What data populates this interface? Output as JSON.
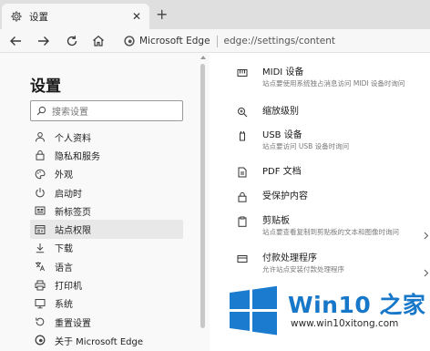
{
  "tab": {
    "title": "设置",
    "icon": "gear-icon",
    "close": "✕",
    "new_tab": "+"
  },
  "toolbar": {
    "back": "back-arrow-icon",
    "forward": "forward-arrow-icon",
    "refresh": "refresh-icon",
    "home": "home-icon"
  },
  "address": {
    "brand": "Microsoft Edge",
    "url": "edge://settings/content"
  },
  "sidebar": {
    "title": "设置",
    "search_placeholder": "搜索设置",
    "items": [
      {
        "label": "个人资料",
        "icon": "person-icon",
        "active": false
      },
      {
        "label": "隐私和服务",
        "icon": "lock-icon",
        "active": false
      },
      {
        "label": "外观",
        "icon": "palette-icon",
        "active": false
      },
      {
        "label": "启动时",
        "icon": "power-icon",
        "active": false
      },
      {
        "label": "新标签页",
        "icon": "newtab-icon",
        "active": false
      },
      {
        "label": "站点权限",
        "icon": "site-permissions-icon",
        "active": true
      },
      {
        "label": "下载",
        "icon": "download-icon",
        "active": false
      },
      {
        "label": "语言",
        "icon": "language-icon",
        "active": false
      },
      {
        "label": "打印机",
        "icon": "printer-icon",
        "active": false
      },
      {
        "label": "系统",
        "icon": "system-icon",
        "active": false
      },
      {
        "label": "重置设置",
        "icon": "reset-icon",
        "active": false
      },
      {
        "label": "关于 Microsoft Edge",
        "icon": "edge-icon",
        "active": false
      }
    ]
  },
  "permissions": [
    {
      "title": "MIDI 设备",
      "desc": "站点要使用系统独占消息访问 MIDI 设备时询问",
      "icon": "midi-icon"
    },
    {
      "title": "缩放级别",
      "desc": "",
      "icon": "zoom-icon"
    },
    {
      "title": "USB 设备",
      "desc": "站点要访问 USB 设备时询问",
      "icon": "usb-icon"
    },
    {
      "title": "PDF 文档",
      "desc": "",
      "icon": "pdf-icon"
    },
    {
      "title": "受保护内容",
      "desc": "",
      "icon": "lock-icon"
    },
    {
      "title": "剪贴板",
      "desc": "站点要查看复制到剪贴板的文本和图像时询问",
      "icon": "clipboard-icon"
    },
    {
      "title": "付款处理程序",
      "desc": "允许站点安装付款处理程序",
      "icon": "payment-icon"
    }
  ],
  "watermark": {
    "name": "Win10 之家",
    "url": "www.win10xitong.com"
  },
  "colors": {
    "accent": "#1777c8",
    "tabstrip": "#dfdfdf",
    "sidebar": "#f9f9f9",
    "active_item": "#e8e8e8"
  }
}
